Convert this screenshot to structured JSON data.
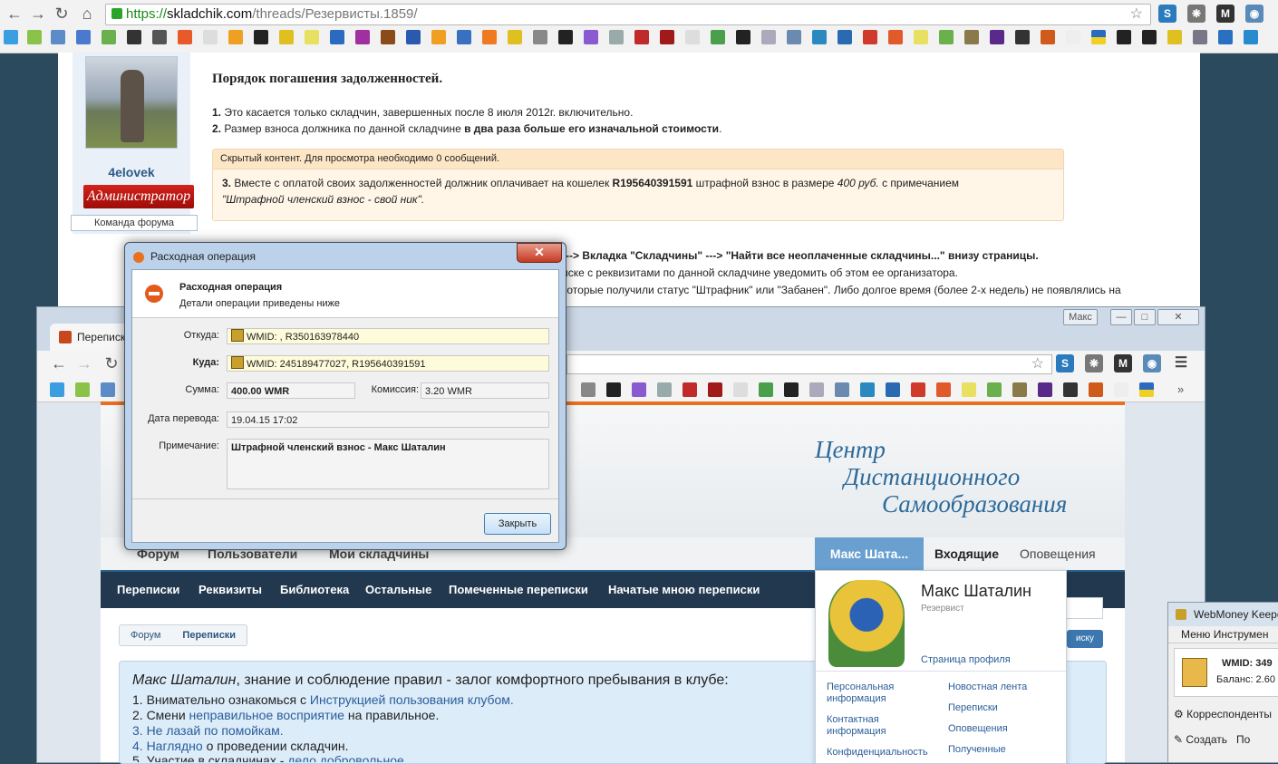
{
  "browser": {
    "url_https": "https://",
    "url_host": "skladchik.com",
    "url_path": "/threads/Резервисты.1859/"
  },
  "post": {
    "author": "4elovek",
    "role_badge": "Администратор",
    "team_label": "Команда форума",
    "title": "Порядок погашения задолженностей.",
    "line1_num": "1.",
    "line1": "Это касается только складчин, завершенных после 8 июля 2012г. включительно.",
    "line2_num": "2.",
    "line2_a": "Размер взноса должника по данной складчине",
    "line2_b": "в два раза больше его изначальной стоимости",
    "hidden_header": "Скрытый контент. Для просмотра необходимо 0 сообщений.",
    "hidden_num": "3.",
    "hidden_a": "Вместе с оплатой своих задолженностей должник оплачивает на кошелек",
    "hidden_wallet": "R195640391591",
    "hidden_b": "штрафной взнос в размере",
    "hidden_amount": "400 руб.",
    "hidden_c": "с примечанием",
    "hidden_note": "\"Штрафной членский взнос - свой ник\".",
    "behind1": "---> Вкладка \"Складчины\" ---> \"Найти все неоплаченные складчины...\" внизу страницы.",
    "behind2": "иске с реквизитами по данной складчине уведомить об этом ее организатора.",
    "behind3": "которые получили статус \"Штрафник\" или \"Забанен\". Либо долгое время (более 2-х недель) не появлялись на"
  },
  "dialog": {
    "title": "Расходная операция",
    "header_title": "Расходная операция",
    "header_sub": "Детали операции приведены ниже",
    "from_label": "Откуда:",
    "from_value": "WMID: , R350163978440",
    "to_label": "Куда:",
    "to_value": "WMID: 245189477027, R195640391591",
    "sum_label": "Сумма:",
    "sum_value": "400.00 WMR",
    "fee_label": "Комиссия:",
    "fee_value": "3.20 WMR",
    "date_label": "Дата перевода:",
    "date_value": "19.04.15 17:02",
    "note_label": "Примечание:",
    "note_value": "Штрафной членский взнос - Макс Шаталин",
    "close_button": "Закрыть"
  },
  "window2": {
    "tab_label": "Переписк",
    "user_btn": "Макс",
    "logo_line1": "Центр",
    "logo_line2": "Дистанционного",
    "logo_line3": "Самообразования",
    "nav": [
      "Форум",
      "Пользователи",
      "Мои складчины"
    ],
    "userbox_tab": "Макс Шата...",
    "inbox": "Входящие",
    "alerts": "Оповещения",
    "subnav": [
      "Переписки",
      "Реквизиты",
      "Библиотека",
      "Остальные",
      "Помеченные переписки",
      "Начатые мною переписки"
    ],
    "crumbs": [
      "Форум",
      "Переписки"
    ],
    "notice_name": "Макс Шаталин",
    "notice_rest": ", знание и соблюдение правил - залог комфортного пребывания в клубе:",
    "notice_l1_a": "1. Внимательно ознакомься с ",
    "notice_l1_link": "Инструкцией пользования клубом.",
    "notice_l2_a": "2. Смени ",
    "notice_l2_link": "неправильное восприятие",
    "notice_l2_b": " на правильное.",
    "notice_l3": "3. Не лазай по помойкам.",
    "notice_l4_link": "4. Наглядно",
    "notice_l4_b": " о проведении складчин.",
    "notice_l5_a": "5. Участие в складчинах - ",
    "notice_l5_link": "дело добровольное",
    "dd_name": "Макс Шаталин",
    "dd_role": "Резервист",
    "dd_profile": "Страница профиля",
    "dd_left": [
      "Персональная информация",
      "Контактная информация",
      "Конфиденциальность"
    ],
    "dd_right": [
      "Новостная лента",
      "Переписки",
      "Оповещения",
      "Полученные"
    ],
    "search_btn": "иску"
  },
  "keeper": {
    "title": "WebMoney Keeper",
    "menu": "Меню   Инструмен",
    "wmid": "WMID: 349",
    "balance": "Баланс: 2.60",
    "corr": "Корреспонденты",
    "create": "Создать",
    "po": "По"
  }
}
